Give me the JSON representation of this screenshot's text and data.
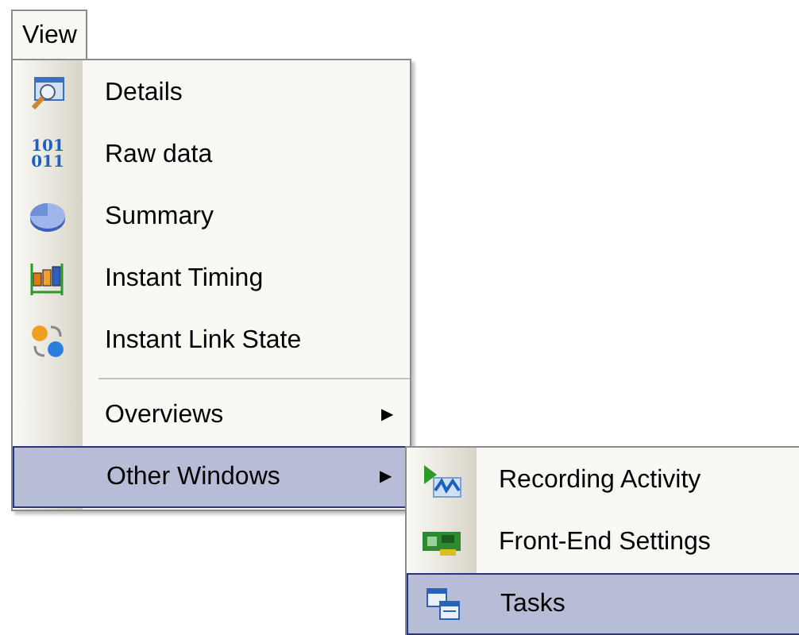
{
  "menu_bar": [
    {
      "label": "View",
      "selected": true
    }
  ],
  "menu": {
    "items": [
      {
        "kind": "command",
        "label": "Details",
        "selected": false
      },
      {
        "kind": "command",
        "label": "Raw data",
        "icon_text": [
          "101",
          "011"
        ],
        "selected": false
      },
      {
        "kind": "command",
        "label": "Summary",
        "selected": false
      },
      {
        "kind": "command",
        "label": "Instant Timing",
        "selected": false
      },
      {
        "kind": "command",
        "label": "Instant Link State",
        "selected": false
      },
      {
        "kind": "separator"
      },
      {
        "kind": "submenu",
        "label": "Overviews",
        "arrow": "▶",
        "selected": false
      },
      {
        "kind": "submenu",
        "label": "Other Windows",
        "arrow": "▶",
        "selected": true
      }
    ]
  },
  "submenu": {
    "items": [
      {
        "kind": "command",
        "label": "Recording Activity",
        "selected": false
      },
      {
        "kind": "command",
        "label": "Front-End Settings",
        "selected": false
      },
      {
        "kind": "command",
        "label": "Tasks",
        "selected": true
      }
    ]
  }
}
